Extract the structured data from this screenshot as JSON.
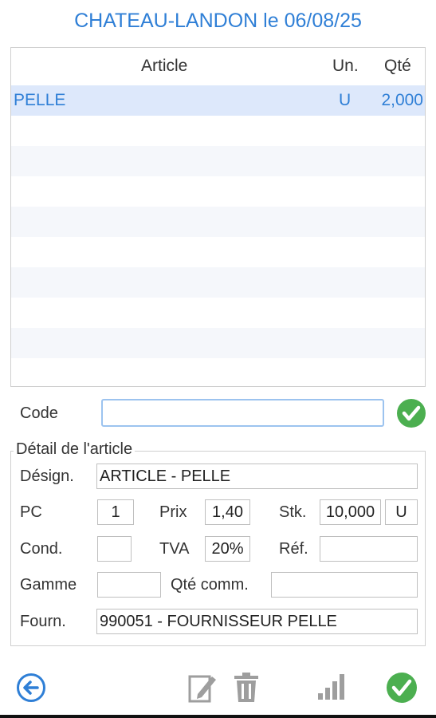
{
  "header": {
    "title": "CHATEAU-LANDON le 06/08/25"
  },
  "grid": {
    "columns": {
      "article": "Article",
      "unit": "Un.",
      "qty": "Qté"
    },
    "rows": [
      {
        "article": "PELLE",
        "unit": "U",
        "qty": "2,000"
      }
    ]
  },
  "code": {
    "label": "Code",
    "value": ""
  },
  "detail": {
    "legend": "Détail de l'article",
    "designation_label": "Désign.",
    "designation": "ARTICLE - PELLE",
    "pc_label": "PC",
    "pc": "1",
    "prix_label": "Prix",
    "prix": "1,40",
    "stk_label": "Stk.",
    "stk": "10,000",
    "stk_unit": "U",
    "cond_label": "Cond.",
    "cond": "",
    "tva_label": "TVA",
    "tva": "20%",
    "ref_label": "Réf.",
    "ref": "",
    "gamme_label": "Gamme",
    "gamme": "",
    "qte_comm_label": "Qté comm.",
    "qte_comm": "",
    "fourn_label": "Fourn.",
    "fourn": "990051 - FOURNISSEUR PELLE"
  },
  "colors": {
    "accent": "#2f7fd6",
    "confirm": "#4caf50",
    "icon_gray": "#9e9e9e",
    "selected_row": "#dde8fb"
  },
  "icons": [
    "confirm-icon",
    "back-icon",
    "edit-icon",
    "trash-icon",
    "signal-icon",
    "confirm-icon"
  ]
}
